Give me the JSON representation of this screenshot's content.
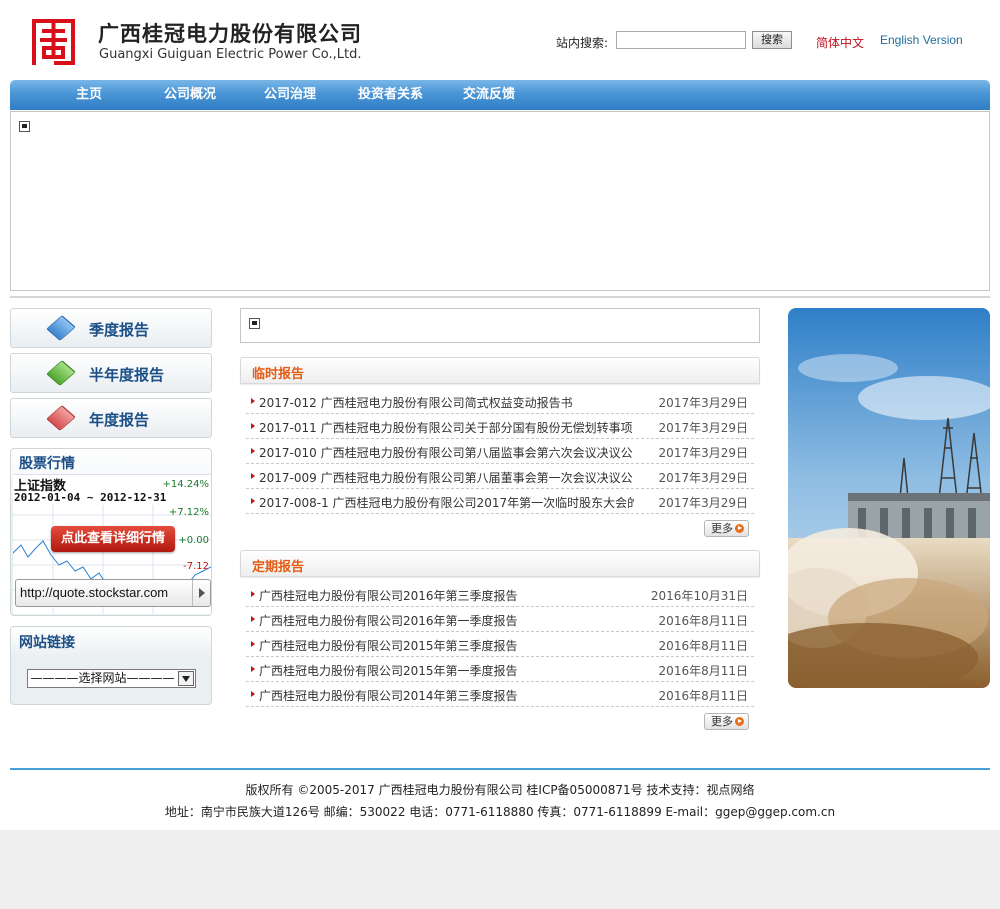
{
  "header": {
    "company_cn": "广西桂冠电力股份有限公司",
    "company_en": "Guangxi Guiguan Electric Power Co.,Ltd.",
    "search_label": "站内搜索:",
    "search_value": "",
    "search_button": "搜索",
    "lang_cn": "简体中文",
    "lang_en": "English Version"
  },
  "nav": {
    "items": [
      {
        "label": "主页"
      },
      {
        "label": "公司概况"
      },
      {
        "label": "公司治理"
      },
      {
        "label": "投资者关系"
      },
      {
        "label": "交流反馈"
      }
    ]
  },
  "left": {
    "reports": [
      {
        "label": "季度报告",
        "color": "#5aa0e0"
      },
      {
        "label": "半年度报告",
        "color": "#6cc34a"
      },
      {
        "label": "年度报告",
        "color": "#e06a6a"
      }
    ],
    "stock": {
      "title": "股票行情",
      "index_name": "上证指数",
      "range": "2012-01-04 ~ 2012-12-31",
      "pcts": [
        "+14.24%",
        "+7.12%",
        "+0.00",
        "-7.12"
      ],
      "cta": "点此查看详细行情",
      "url": "http://quote.stockstar.com"
    },
    "links": {
      "title": "网站链接",
      "select_value": "————选择网站————"
    }
  },
  "main": {
    "temporary": {
      "title": "临时报告",
      "items": [
        {
          "title": "2017-012 广西桂冠电力股份有限公司简式权益变动报告书",
          "date": "2017年3月29日"
        },
        {
          "title": "2017-011 广西桂冠电力股份有限公司关于部分国有股份无偿划转事项",
          "date": "2017年3月29日"
        },
        {
          "title": "2017-010 广西桂冠电力股份有限公司第八届监事会第六次会议决议公",
          "date": "2017年3月29日"
        },
        {
          "title": "2017-009 广西桂冠电力股份有限公司第八届董事会第一次会议决议公",
          "date": "2017年3月29日"
        },
        {
          "title": "2017-008-1 广西桂冠电力股份有限公司2017年第一次临时股东大会的",
          "date": "2017年3月29日"
        }
      ],
      "more": "更多"
    },
    "periodic": {
      "title": "定期报告",
      "items": [
        {
          "title": "广西桂冠电力股份有限公司2016年第三季度报告",
          "date": "2016年10月31日"
        },
        {
          "title": "广西桂冠电力股份有限公司2016年第一季度报告",
          "date": "2016年8月11日"
        },
        {
          "title": "广西桂冠电力股份有限公司2015年第三季度报告",
          "date": "2016年8月11日"
        },
        {
          "title": "广西桂冠电力股份有限公司2015年第一季度报告",
          "date": "2016年8月11日"
        },
        {
          "title": "广西桂冠电力股份有限公司2014年第三季度报告",
          "date": "2016年8月11日"
        }
      ],
      "more": "更多"
    }
  },
  "footer": {
    "line1": "版权所有 ©2005-2017  广西桂冠电力股份有限公司  桂ICP备05000871号  技术支持：视点网络",
    "line2": "地址：南宁市民族大道126号  邮编：530022  电话：0771-6118880  传真：0771-6118899  E-mail：ggep@ggep.com.cn"
  },
  "colors": {
    "nav_blue": "#3a88cc",
    "section_title_orange": "#e55b14",
    "lang_cn_red": "#c0111e",
    "footer_line": "#4a9ed6"
  }
}
